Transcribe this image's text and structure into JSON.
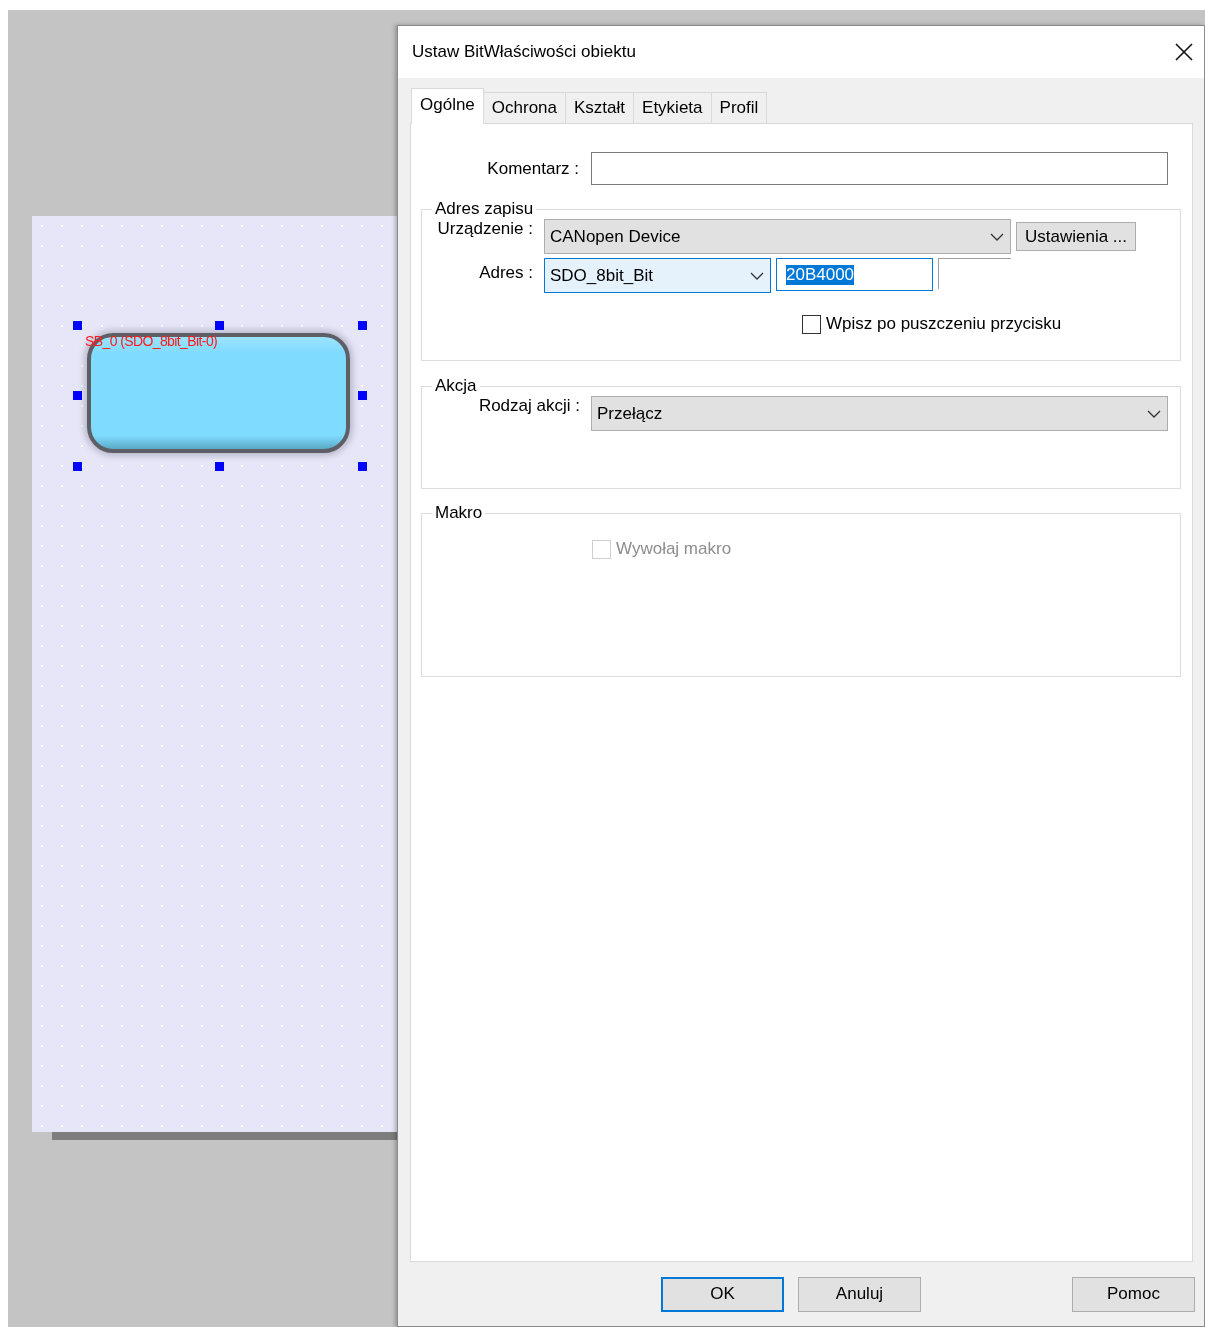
{
  "canvas": {
    "object": {
      "label": "SB_0 (SDO_8bit_Bit-0)",
      "selected": true
    }
  },
  "dialog": {
    "title": "Ustaw BitWłaściwości obiektu",
    "tabs": [
      {
        "label": "Ogólne",
        "selected": true
      },
      {
        "label": "Ochrona",
        "selected": false
      },
      {
        "label": "Kształt",
        "selected": false
      },
      {
        "label": "Etykieta",
        "selected": false
      },
      {
        "label": "Profil",
        "selected": false
      }
    ],
    "comment": {
      "label": "Komentarz :"
    },
    "write_address": {
      "title": "Adres zapisu",
      "device": {
        "label": "Urządzenie :",
        "value": "CANopen Device"
      },
      "settings_button": "Ustawienia ...",
      "address": {
        "label": "Adres :",
        "type": "SDO_8bit_Bit",
        "value": "20B4000",
        "value_selected": true
      },
      "release_checkbox": {
        "label": "Wpisz po puszczeniu przycisku",
        "checked": false
      }
    },
    "action": {
      "title": "Akcja",
      "label": "Rodzaj akcji :",
      "value": "Przełącz"
    },
    "macro": {
      "title": "Makro",
      "checkbox": {
        "label": "Wywołaj makro",
        "checked": false,
        "disabled": true
      }
    },
    "buttons": [
      {
        "label": "OK",
        "default": true
      },
      {
        "label": "Anuluj",
        "default": false
      },
      {
        "label": "Pomoc",
        "default": false
      }
    ]
  }
}
